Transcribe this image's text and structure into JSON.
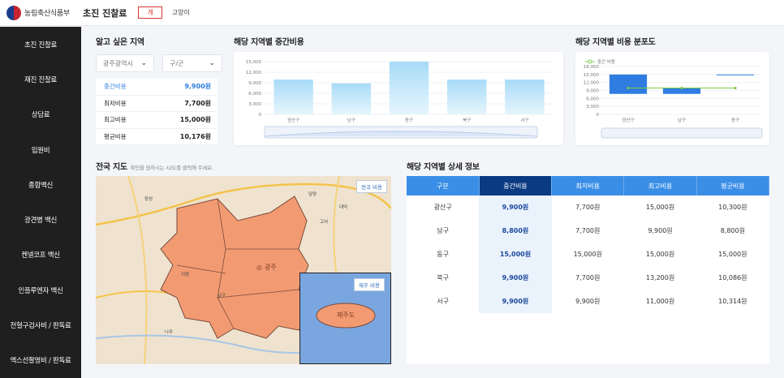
{
  "header": {
    "logo_text": "농림축산식품부",
    "title": "초진 진찰료",
    "tab_dog": "개",
    "tab_cat": "고양이"
  },
  "sidebar": {
    "items": [
      {
        "label": "초진 진찰료"
      },
      {
        "label": "재진 진찰료"
      },
      {
        "label": "상담료"
      },
      {
        "label": "입원비"
      },
      {
        "label": "종합백신"
      },
      {
        "label": "광견병 백신"
      },
      {
        "label": "켄넬코프 백신"
      },
      {
        "label": "인플루엔자 백신"
      },
      {
        "label": "전혈구검사비 / 판독료"
      },
      {
        "label": "엑스선촬영비 / 판독료"
      }
    ]
  },
  "region_select": {
    "title": "알고 싶은 지역",
    "province": "광주광역시",
    "district_placeholder": "구/군"
  },
  "cost_summary": [
    {
      "label": "중간비용",
      "value": "9,900원"
    },
    {
      "label": "최저비용",
      "value": "7,700원"
    },
    {
      "label": "최고비용",
      "value": "15,000원"
    },
    {
      "label": "평균비용",
      "value": "10,176원"
    }
  ],
  "median_chart": {
    "title": "해당 지역별 중간비용",
    "chart_data": {
      "type": "bar",
      "categories": [
        "광산구",
        "남구",
        "동구",
        "북구",
        "서구"
      ],
      "values": [
        9900,
        8800,
        15000,
        9900,
        9900
      ],
      "yticks": [
        "15,000",
        "12,000",
        "9,000",
        "6,000",
        "3,000",
        "0"
      ],
      "ylim": [
        0,
        15000
      ],
      "color": "#a8dbf7"
    }
  },
  "dist_chart": {
    "title": "해당 지역별 비용 분포도",
    "legend": "중간 비용",
    "chart_data": {
      "type": "bar",
      "categories": [
        "광산구",
        "남구",
        "동구"
      ],
      "ranges": [
        [
          7700,
          15000
        ],
        [
          7700,
          9900
        ],
        [
          15000,
          15000
        ]
      ],
      "median": [
        9900,
        8800,
        15000
      ],
      "median_line": [
        9900,
        9900,
        9900
      ],
      "yticks": [
        "18,000",
        "15,000",
        "12,000",
        "9,000",
        "6,000",
        "3,000",
        "0"
      ],
      "ylim": [
        0,
        18000
      ],
      "bar_color": "#2f7de0",
      "line_color": "#7ccb47"
    }
  },
  "map": {
    "title": "전국 지도",
    "hint": "확인을 원하시는 시/도를 클릭해 주세요.",
    "nation_button": "전국 비용",
    "jeju_button": "제주 비용",
    "city_label": "광주",
    "jeju_label": "제주도",
    "labels": [
      "담양",
      "고서",
      "대덕",
      "지원",
      "남구",
      "장성",
      "나주"
    ]
  },
  "detail": {
    "title": "해당 지역별 상세 정보",
    "columns": [
      "구분",
      "중간비용",
      "최저비용",
      "최고비용",
      "평균비용"
    ],
    "rows": [
      [
        "광산구",
        "9,900원",
        "7,700원",
        "15,000원",
        "10,300원"
      ],
      [
        "남구",
        "8,800원",
        "7,700원",
        "9,900원",
        "8,800원"
      ],
      [
        "동구",
        "15,000원",
        "15,000원",
        "15,000원",
        "15,000원"
      ],
      [
        "북구",
        "9,900원",
        "7,700원",
        "13,200원",
        "10,086원"
      ],
      [
        "서구",
        "9,900원",
        "9,900원",
        "11,000원",
        "10,314원"
      ]
    ]
  }
}
